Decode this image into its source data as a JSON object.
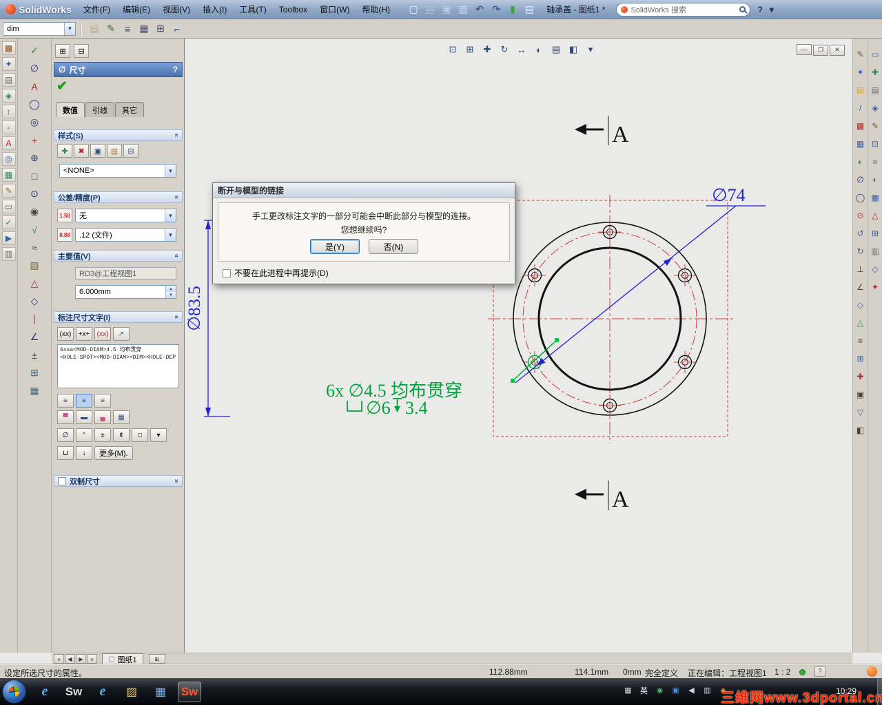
{
  "title_bar": {
    "app_name": "SolidWorks",
    "document_title": "轴承盖 - 图纸1 *",
    "search_text": "SolidWorks 搜索",
    "help_label": "?",
    "collapse_label": "▾",
    "menus": [
      {
        "name": "menu-file",
        "label": "文件(F)"
      },
      {
        "name": "menu-edit",
        "label": "编辑(E)"
      },
      {
        "name": "menu-view",
        "label": "视图(V)"
      },
      {
        "name": "menu-insert",
        "label": "插入(I)"
      },
      {
        "name": "menu-tools",
        "label": "工具(T)"
      },
      {
        "name": "menu-toolbox",
        "label": "Toolbox"
      },
      {
        "name": "menu-window",
        "label": "窗口(W)"
      },
      {
        "name": "menu-help",
        "label": "帮助(H)"
      }
    ],
    "toolbar_icons": [
      {
        "name": "new-document-icon",
        "glyph": "▢",
        "color": "#f2f6fb"
      },
      {
        "name": "open-icon",
        "glyph": "▤",
        "color": "#e6c14e"
      },
      {
        "name": "save-icon",
        "glyph": "▣",
        "color": "#b8cce6"
      },
      {
        "name": "print-icon",
        "glyph": "▥",
        "color": "#d6dee8"
      },
      {
        "name": "undo-icon",
        "glyph": "↶",
        "color": "#27407e"
      },
      {
        "name": "redo-icon",
        "glyph": "↷",
        "color": "#27407e"
      },
      {
        "name": "rebuild-icon",
        "glyph": "▮",
        "color": "#39a83e"
      },
      {
        "name": "options-list-icon",
        "glyph": "▤",
        "color": "#e8edf4"
      }
    ]
  },
  "toolbar2": {
    "style_value": "dim",
    "icons": [
      {
        "name": "open-style-folder-icon",
        "glyph": "▤",
        "color": "#d8a93c"
      },
      {
        "name": "update-style-icon",
        "glyph": "✎",
        "color": "#3c6c3c"
      },
      {
        "name": "layer-list-icon",
        "glyph": "≡",
        "color": "#404a5a"
      },
      {
        "name": "table-format-icon",
        "glyph": "▦",
        "color": "#40507a"
      },
      {
        "name": "grid-icon",
        "glyph": "⊞",
        "color": "#40507a"
      },
      {
        "name": "anchor-corner-icon",
        "glyph": "⌐",
        "color": "#205a8a"
      }
    ]
  },
  "left_strip": {
    "icons": [
      {
        "name": "left-strip-icon",
        "glyph": "▩",
        "color": "#8a5a2a"
      },
      {
        "name": "left-strip-icon",
        "glyph": "✦",
        "color": "#3a62a8"
      },
      {
        "name": "left-strip-icon",
        "glyph": "▤",
        "color": "#6a6a6a"
      },
      {
        "name": "left-strip-icon",
        "glyph": "◈",
        "color": "#2f8a50"
      },
      {
        "name": "left-strip-icon",
        "glyph": "↕",
        "color": "#3a62a8"
      },
      {
        "name": "left-strip-icon",
        "glyph": "▫",
        "color": "#6a6a6a"
      },
      {
        "name": "left-strip-icon",
        "glyph": "A",
        "color": "#c22222"
      },
      {
        "name": "left-strip-icon",
        "glyph": "◎",
        "color": "#3a62a8"
      },
      {
        "name": "left-strip-icon",
        "glyph": "▦",
        "color": "#2f8a50"
      },
      {
        "name": "left-strip-icon",
        "glyph": "✎",
        "color": "#97732a"
      },
      {
        "name": "left-strip-icon",
        "glyph": "▭",
        "color": "#6a6a6a"
      },
      {
        "name": "left-strip-icon",
        "glyph": "✓",
        "color": "#2f8a50"
      },
      {
        "name": "left-strip-icon",
        "glyph": "▶",
        "color": "#3a62a8"
      },
      {
        "name": "left-strip-icon",
        "glyph": "▥",
        "color": "#6a6a6a"
      }
    ]
  },
  "left_toolbar": {
    "icons": [
      {
        "name": "ok-icon",
        "glyph": "✓",
        "color": "#2f8a3c"
      },
      {
        "name": "smart-dimension-icon",
        "glyph": "∅",
        "color": "#223a7a"
      },
      {
        "name": "note-icon",
        "glyph": "A",
        "color": "#b02a2a"
      },
      {
        "name": "balloon-icon",
        "glyph": "◯",
        "color": "#223a7a"
      },
      {
        "name": "auto-balloon-icon",
        "glyph": "◎",
        "color": "#223a7a"
      },
      {
        "name": "center-mark-icon",
        "glyph": "+",
        "color": "#b02a2a"
      },
      {
        "name": "geometric-tolerance-icon",
        "glyph": "⊕",
        "color": "#223a7a"
      },
      {
        "name": "datum-feature-icon",
        "glyph": "□",
        "color": "#444444"
      },
      {
        "name": "datum-target-icon",
        "glyph": "⊙",
        "color": "#223a7a"
      },
      {
        "name": "hole-callout-icon",
        "glyph": "◉",
        "color": "#444444"
      },
      {
        "name": "surface-finish-icon",
        "glyph": "√",
        "color": "#2f8a3c"
      },
      {
        "name": "weld-symbol-icon",
        "glyph": "≈",
        "color": "#444444"
      },
      {
        "name": "hatch-icon",
        "glyph": "▨",
        "color": "#7a6a3a"
      },
      {
        "name": "revision-symbol-icon",
        "glyph": "△",
        "color": "#b02a2a"
      },
      {
        "name": "block-icon",
        "glyph": "◇",
        "color": "#223a7a"
      },
      {
        "name": "centerline-icon",
        "glyph": "∣",
        "color": "#b02a2a"
      },
      {
        "name": "angle-dimension-icon",
        "glyph": "∠",
        "color": "#223a7a"
      },
      {
        "name": "tolerance-icon",
        "glyph": "±",
        "color": "#444444"
      },
      {
        "name": "table-icon",
        "glyph": "⊞",
        "color": "#2f6a9a"
      },
      {
        "name": "general-table-icon",
        "glyph": "▦",
        "color": "#2f6a9a"
      }
    ]
  },
  "right_inner": {
    "icons": [
      {
        "name": "right-tool-icon",
        "glyph": "✎",
        "color": "#7a5a2a"
      },
      {
        "name": "right-tool-icon",
        "glyph": "✦",
        "color": "#3a62a8"
      },
      {
        "name": "right-tool-icon",
        "glyph": "▤",
        "color": "#d8a93c"
      },
      {
        "name": "right-tool-icon",
        "glyph": "/",
        "color": "#3a62a8"
      },
      {
        "name": "right-tool-icon",
        "glyph": "▩",
        "color": "#b03030"
      },
      {
        "name": "right-tool-icon",
        "glyph": "▦",
        "color": "#3a62a8"
      },
      {
        "name": "right-tool-icon",
        "glyph": "◐",
        "color": "#2f8a50"
      },
      {
        "name": "right-tool-icon",
        "glyph": "∅",
        "color": "#223a7a"
      },
      {
        "name": "right-tool-icon",
        "glyph": "◯",
        "color": "#223a7a"
      },
      {
        "name": "right-tool-icon",
        "glyph": "⊙",
        "color": "#b03030"
      },
      {
        "name": "right-tool-icon",
        "glyph": "↺",
        "color": "#3a62a8"
      },
      {
        "name": "right-tool-icon",
        "glyph": "↻",
        "color": "#3a62a8"
      },
      {
        "name": "right-tool-icon",
        "glyph": "⊥",
        "color": "#444444"
      },
      {
        "name": "right-tool-icon",
        "glyph": "∠",
        "color": "#444444"
      },
      {
        "name": "right-tool-icon",
        "glyph": "◇",
        "color": "#3a62a8"
      },
      {
        "name": "right-tool-icon",
        "glyph": "△",
        "color": "#2f8a50"
      },
      {
        "name": "right-tool-icon",
        "glyph": "≡",
        "color": "#444444"
      },
      {
        "name": "right-tool-icon",
        "glyph": "⊞",
        "color": "#3a62a8"
      },
      {
        "name": "right-tool-icon",
        "glyph": "✚",
        "color": "#b03030"
      },
      {
        "name": "right-tool-icon",
        "glyph": "▣",
        "color": "#444444"
      },
      {
        "name": "right-tool-icon",
        "glyph": "▽",
        "color": "#3a62a8"
      },
      {
        "name": "right-tool-icon",
        "glyph": "◧",
        "color": "#444444"
      }
    ]
  },
  "right_outer": {
    "icons": [
      {
        "name": "panel-strip-icon",
        "glyph": "▭",
        "color": "#3a62a8"
      },
      {
        "name": "panel-strip-icon",
        "glyph": "✚",
        "color": "#2f8a50"
      },
      {
        "name": "panel-strip-icon",
        "glyph": "▤",
        "color": "#6a6a6a"
      },
      {
        "name": "panel-strip-icon",
        "glyph": "◈",
        "color": "#3a62a8"
      },
      {
        "name": "panel-strip-icon",
        "glyph": "✎",
        "color": "#7a5a2a"
      },
      {
        "name": "panel-strip-icon",
        "glyph": "⊡",
        "color": "#3a62a8"
      },
      {
        "name": "panel-strip-icon",
        "glyph": "≡",
        "color": "#6a6a6a"
      },
      {
        "name": "panel-strip-icon",
        "glyph": "◐",
        "color": "#2f8a50"
      },
      {
        "name": "panel-strip-icon",
        "glyph": "▦",
        "color": "#3a62a8"
      },
      {
        "name": "panel-strip-icon",
        "glyph": "△",
        "color": "#b03030"
      },
      {
        "name": "panel-strip-icon",
        "glyph": "⊞",
        "color": "#3a62a8"
      },
      {
        "name": "panel-strip-icon",
        "glyph": "▥",
        "color": "#6a6a6a"
      },
      {
        "name": "panel-strip-icon",
        "glyph": "◇",
        "color": "#3a62a8"
      },
      {
        "name": "panel-strip-icon",
        "glyph": "✦",
        "color": "#b03030"
      }
    ]
  },
  "view_toolbar": {
    "icons": [
      {
        "name": "zoom-fit-icon",
        "glyph": "⊡",
        "color": "#2a4a7a"
      },
      {
        "name": "zoom-area-icon",
        "glyph": "⊞",
        "color": "#2a4a7a"
      },
      {
        "name": "zoom-inout-icon",
        "glyph": "✚",
        "color": "#2a4a7a"
      },
      {
        "name": "rotate-view-icon",
        "glyph": "↻",
        "color": "#2a4a7a"
      },
      {
        "name": "pan-icon",
        "glyph": "↔",
        "color": "#2a4a7a"
      },
      {
        "name": "shaded-display-icon",
        "glyph": "◐",
        "color": "#2a4a7a"
      },
      {
        "name": "display-style-icon",
        "glyph": "▤",
        "color": "#2a4a7a"
      },
      {
        "name": "section-view-icon",
        "glyph": "◧",
        "color": "#2a4a7a"
      },
      {
        "name": "view-settings-dropdown-icon",
        "glyph": "▾",
        "color": "#2a4a7a"
      }
    ]
  },
  "doc_window": {
    "controls": [
      {
        "name": "doc-minimize-button",
        "glyph": "—"
      },
      {
        "name": "doc-restore-button",
        "glyph": "❐"
      },
      {
        "name": "doc-close-button",
        "glyph": "✕"
      }
    ]
  },
  "property_manager": {
    "title": "尺寸",
    "help": "?",
    "tabs": [
      {
        "name": "pm-tab-value",
        "label": "数值",
        "cls": "active"
      },
      {
        "name": "pm-tab-leaders",
        "label": "引线"
      },
      {
        "name": "pm-tab-other",
        "label": "其它"
      }
    ],
    "style": {
      "label": "样式(S)",
      "value": "<NONE>",
      "buttons": [
        {
          "name": "add-style-icon",
          "glyph": "✚",
          "color": "#2f8a3c"
        },
        {
          "name": "delete-style-icon",
          "glyph": "✖",
          "color": "#b02a2a"
        },
        {
          "name": "save-style-icon",
          "glyph": "▣",
          "color": "#2a4a7a"
        },
        {
          "name": "load-style-icon",
          "glyph": "▤",
          "color": "#9a7a2a"
        },
        {
          "name": "update-style-icon",
          "glyph": "⊟",
          "color": "#2a4a7a"
        }
      ]
    },
    "tolerance": {
      "label": "公差/精度(P)",
      "icon1": "1.50",
      "icon2": "8.88",
      "type_value": "无",
      "precision_value": ".12 (文件)"
    },
    "primary": {
      "label": "主要值(V)",
      "name": "RD3@工程视图1",
      "value": "6.000mm"
    },
    "dim_text": {
      "label": "标注尺寸文字(I)",
      "line1": "6xsa<MOD-DIAM>4.5 均布贯穿",
      "line2": "<HOLE-SPOT><MOD-DIAM><DIM><HOLE-DEP",
      "more_label": "更多(M).",
      "buttons": [
        {
          "name": "dim-value-button",
          "label": "(xx)"
        },
        {
          "name": "dim-prefix-button",
          "label": "+x+"
        },
        {
          "name": "dim-suffix-button",
          "label": "(xx)",
          "color": "#b02a2a"
        },
        {
          "name": "leader-button",
          "glyph": "↗",
          "color": "#2a4a7a"
        }
      ],
      "align_buttons": [
        {
          "name": "align-left-button",
          "glyph": "≡",
          "color": "#2a4a7a"
        },
        {
          "name": "align-center-button",
          "glyph": "≡",
          "color": "#2a4a7a",
          "cls": "active"
        },
        {
          "name": "align-right-button",
          "glyph": "≡",
          "color": "#2a4a7a"
        }
      ],
      "format_buttons": [
        {
          "name": "justify-top-button",
          "glyph": "▀",
          "color": "#c05a8a"
        },
        {
          "name": "justify-middle-button",
          "glyph": "▬",
          "color": "#2a4a7a"
        },
        {
          "name": "justify-bottom-button",
          "glyph": "▄",
          "color": "#c05a8a"
        },
        {
          "name": "justify-outside-button",
          "glyph": "▦",
          "color": "#2a4a7a"
        }
      ],
      "symbol_buttons": [
        {
          "name": "diameter-symbol-button",
          "label": "∅"
        },
        {
          "name": "degree-symbol-button",
          "label": "°"
        },
        {
          "name": "plusminus-symbol-button",
          "label": "±"
        },
        {
          "name": "centerline-symbol-button",
          "label": "¢"
        },
        {
          "name": "square-symbol-button",
          "label": "□"
        },
        {
          "name": "more-symbols-dropdown",
          "label": "▾"
        }
      ],
      "extra_buttons": [
        {
          "name": "counterbore-symbol-button",
          "label": "⊔"
        },
        {
          "name": "depth-symbol-button",
          "label": "↓"
        }
      ]
    },
    "dual": {
      "label": "双制尺寸"
    }
  },
  "dialog": {
    "title": "断开与模型的链接",
    "message_line1": "手工更改标注文字的一部分可能会中断此部分与模型的连接。",
    "message_line2": "您想继续吗?",
    "yes_label": "是(Y)",
    "no_label": "否(N)",
    "checkbox_label": "不要在此进程中再提示(D)"
  },
  "drawing": {
    "dim_74": "∅74",
    "dim_83_5": "∅83.5",
    "callout_line1": "6x ∅4.5 均布贯穿",
    "callout_d": "∅6",
    "callout_depth": "3.4",
    "section_letter_top": "A",
    "section_letter_bottom": "A"
  },
  "sheet_bar": {
    "tab_label": "图纸1",
    "nav": [
      {
        "name": "first-sheet-button",
        "label": "«"
      },
      {
        "name": "prev-sheet-button",
        "label": "◀"
      },
      {
        "name": "next-sheet-button",
        "label": "▶"
      },
      {
        "name": "last-sheet-button",
        "label": "»"
      }
    ]
  },
  "status_bar": {
    "hint": "设定所选尺寸的属性。",
    "x": "112.88mm",
    "y": "114.1mm",
    "z": "0mm",
    "state": "完全定义",
    "editing": "正在编辑：工程视图1",
    "scale": "1 : 2",
    "help": "?"
  },
  "taskbar": {
    "time": "10:29",
    "quick_launch": [
      {
        "name": "ie-quicklaunch-icon",
        "label": "e",
        "cls": "ie"
      },
      {
        "name": "solidworks-quicklaunch-icon",
        "label": "Sw",
        "cls": "sw"
      },
      {
        "name": "ie2-quicklaunch-icon",
        "label": "e",
        "cls": "ie"
      },
      {
        "name": "folder-quicklaunch-icon",
        "glyph": "▨",
        "color": "#e8c34e"
      },
      {
        "name": "app-quicklaunch-icon",
        "glyph": "▦",
        "color": "#7fb0e8"
      },
      {
        "name": "solidworks-taskbar-button",
        "label": "Sw",
        "cls": "sw-active active"
      }
    ],
    "tray": [
      {
        "name": "input-indicator-icon",
        "glyph": "▦",
        "color": "#cfd6df"
      },
      {
        "name": "language-indicator",
        "label": "英",
        "color": "#ffffff"
      },
      {
        "name": "antivirus-tray-icon",
        "glyph": "◉",
        "color": "#49b84e"
      },
      {
        "name": "update-tray-icon",
        "glyph": "▣",
        "color": "#4f8fd8"
      },
      {
        "name": "volume-tray-icon",
        "glyph": "◀",
        "color": "#cfd6df"
      },
      {
        "name": "network-tray-icon",
        "glyph": "▥",
        "color": "#cfd6df"
      },
      {
        "name": "safety-tray-icon",
        "glyph": "◈",
        "color": "#d89a4e"
      }
    ]
  },
  "watermark": "三维网www.3dportal.cn"
}
